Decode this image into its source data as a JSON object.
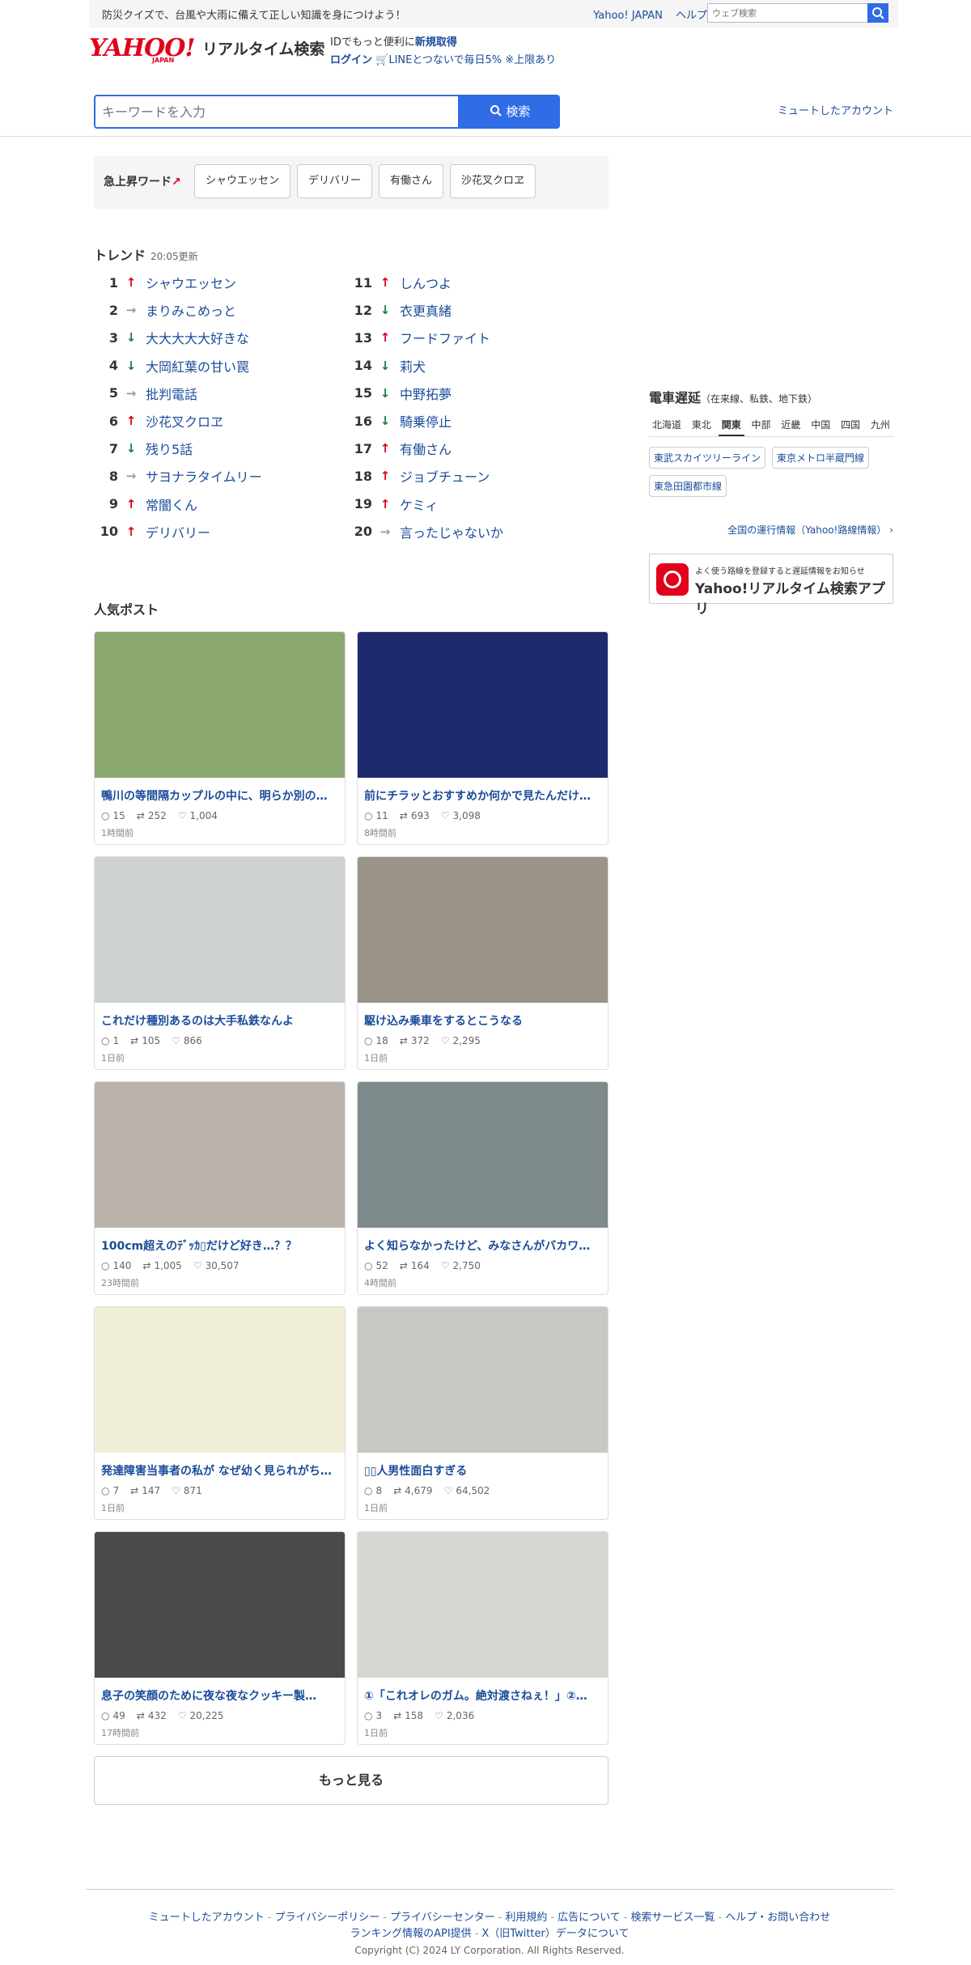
{
  "topbar": {
    "notice": "防災クイズで、台風や大雨に備えて正しい知識を身につけよう！",
    "yahoo_japan": "Yahoo! JAPAN",
    "help": "ヘルプ",
    "web_search_placeholder": "ウェブ検索"
  },
  "header": {
    "logo": "YAHOO!",
    "logo_sub": "JAPAN",
    "service_name": "リアルタイム検索",
    "id_line_prefix": "IDでもっと便利に",
    "signup": "新規取得",
    "login": "ログイン",
    "line_promo": "LINEとつないで毎日5% ※上限あり",
    "search_placeholder": "キーワードを入力",
    "search_button": "検索",
    "muted_accounts": "ミュートしたアカウント"
  },
  "rising": {
    "label": "急上昇ワード",
    "words": [
      "シャウエッセン",
      "デリバリー",
      "有働さん",
      "沙花叉クロヱ"
    ]
  },
  "trend": {
    "title": "トレンド",
    "updated": "20:05更新",
    "items": [
      {
        "rank": "1",
        "dir": "up",
        "word": "シャウエッセン"
      },
      {
        "rank": "2",
        "dir": "flat",
        "word": "まりみこめっと"
      },
      {
        "rank": "3",
        "dir": "down",
        "word": "大大大大大好きな"
      },
      {
        "rank": "4",
        "dir": "down",
        "word": "大岡紅葉の甘い罠"
      },
      {
        "rank": "5",
        "dir": "flat",
        "word": "批判電話"
      },
      {
        "rank": "6",
        "dir": "up",
        "word": "沙花叉クロヱ"
      },
      {
        "rank": "7",
        "dir": "down",
        "word": "残り5話"
      },
      {
        "rank": "8",
        "dir": "flat",
        "word": "サヨナラタイムリー"
      },
      {
        "rank": "9",
        "dir": "up",
        "word": "常闇くん"
      },
      {
        "rank": "10",
        "dir": "up",
        "word": "デリバリー"
      },
      {
        "rank": "11",
        "dir": "up",
        "word": "しんつよ"
      },
      {
        "rank": "12",
        "dir": "down",
        "word": "衣更真緒"
      },
      {
        "rank": "13",
        "dir": "up",
        "word": "フードファイト"
      },
      {
        "rank": "14",
        "dir": "down",
        "word": "莉犬"
      },
      {
        "rank": "15",
        "dir": "down",
        "word": "中野拓夢"
      },
      {
        "rank": "16",
        "dir": "down",
        "word": "騎乗停止"
      },
      {
        "rank": "17",
        "dir": "up",
        "word": "有働さん"
      },
      {
        "rank": "18",
        "dir": "up",
        "word": "ジョブチューン"
      },
      {
        "rank": "19",
        "dir": "up",
        "word": "ケミィ"
      },
      {
        "rank": "20",
        "dir": "flat",
        "word": "言ったじゃないか"
      }
    ]
  },
  "popular": {
    "title": "人気ポスト",
    "posts": [
      {
        "title": "鴨川の等間隔カップルの中に、明らか別の…",
        "replies": "15",
        "reposts": "252",
        "likes": "1,004",
        "ago": "1時間前",
        "thumb_color": "#8aa870"
      },
      {
        "title": "前にチラッとおすすめか何かで見たんだけ…",
        "replies": "11",
        "reposts": "693",
        "likes": "3,098",
        "ago": "8時間前",
        "thumb_color": "#1e2a6b"
      },
      {
        "title": "これだけ種別あるのは大手私鉄なんよ",
        "replies": "1",
        "reposts": "105",
        "likes": "866",
        "ago": "1日前",
        "thumb_color": "#cfd2d3"
      },
      {
        "title": "駆け込み乗車をするとこうなる",
        "replies": "18",
        "reposts": "372",
        "likes": "2,295",
        "ago": "1日前",
        "thumb_color": "#9a9486"
      },
      {
        "title": "100cm超えのﾃﾞｯｶ▯だけど好き…？？",
        "replies": "140",
        "reposts": "1,005",
        "likes": "30,507",
        "ago": "23時間前",
        "thumb_color": "#b9b3ac"
      },
      {
        "title": "よく知らなかったけど、みなさんがバカワ…",
        "replies": "52",
        "reposts": "164",
        "likes": "2,750",
        "ago": "4時間前",
        "thumb_color": "#7f8a8c"
      },
      {
        "title": "発達障害当事者の私が なぜ幼く見られがち…",
        "replies": "7",
        "reposts": "147",
        "likes": "871",
        "ago": "1日前",
        "thumb_color": "#f1eed7"
      },
      {
        "title": "▯▯人男性面白すぎる",
        "replies": "8",
        "reposts": "4,679",
        "likes": "64,502",
        "ago": "1日前",
        "thumb_color": "#c9c7c1"
      },
      {
        "title": "息子の笑顔のために夜な夜なクッキー製…",
        "replies": "49",
        "reposts": "432",
        "likes": "20,225",
        "ago": "17時間前",
        "thumb_color": "#4a4a4a"
      },
      {
        "title": "①「これオレのガム。絶対渡さねぇ！」②…",
        "replies": "3",
        "reposts": "158",
        "likes": "2,036",
        "ago": "1日前",
        "thumb_color": "#d8d6d2"
      }
    ],
    "more_button": "もっと見る"
  },
  "rail": {
    "title": "電車遅延",
    "subtitle": "（在来線、私鉄、地下鉄）",
    "regions": [
      "北海道",
      "東北",
      "関東",
      "中部",
      "近畿",
      "中国",
      "四国",
      "九州"
    ],
    "selected_region": "関東",
    "lines": [
      "東武スカイツリーライン",
      "東京メトロ半蔵門線",
      "東急田園都市線"
    ],
    "all_info": "全国の運行情報（Yahoo!路線情報）",
    "app_small": "よく使う路線を登録すると遅延情報をお知らせ",
    "app_name": "Yahoo!リアルタイム検索アプリ"
  },
  "footer": {
    "links": [
      "ミュートしたアカウント",
      "プライバシーポリシー",
      "プライバシーセンター",
      "利用規約",
      "広告について",
      "検索サービス一覧",
      "ヘルプ・お問い合わせ"
    ],
    "links2": [
      "ランキング情報のAPI提供",
      "X（旧Twitter）データについて"
    ],
    "copyright": "Copyright (C) 2024 LY Corporation. All Rights Reserved."
  }
}
